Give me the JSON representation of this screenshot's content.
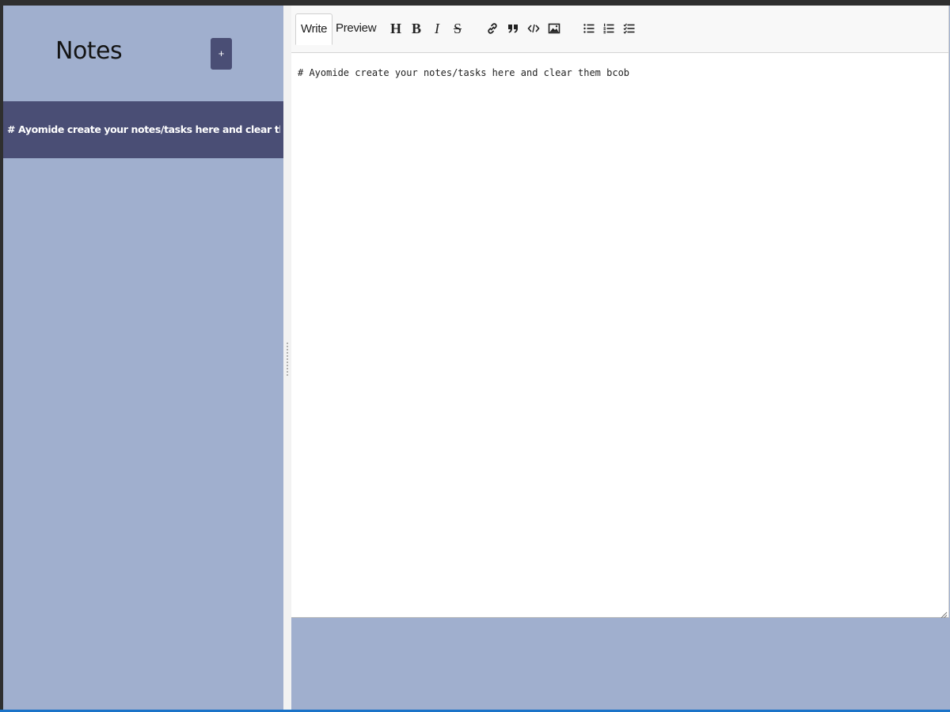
{
  "sidebar": {
    "title": "Notes",
    "new_button_label": "+",
    "notes": [
      {
        "title": "# Ayomide create your notes/tasks here and clear them bcob"
      }
    ]
  },
  "editor": {
    "tabs": [
      {
        "label": "Write",
        "active": true
      },
      {
        "label": "Preview",
        "active": false
      }
    ],
    "toolbar_icons": [
      "header-icon",
      "bold-icon",
      "italic-icon",
      "strikethrough-icon",
      "link-icon",
      "quote-icon",
      "code-icon",
      "image-icon",
      "unordered-list-icon",
      "ordered-list-icon",
      "checked-list-icon"
    ],
    "toolbar_glyphs": {
      "header": "H",
      "bold": "B",
      "italic": "I",
      "strike": "S"
    },
    "content": "# Ayomide create your notes/tasks here and clear them bcob"
  },
  "colors": {
    "sidebar_bg": "#a0afce",
    "accent": "#4a4e75",
    "editor_bg": "#ffffff",
    "toolbar_bg": "#f8f8f8"
  }
}
